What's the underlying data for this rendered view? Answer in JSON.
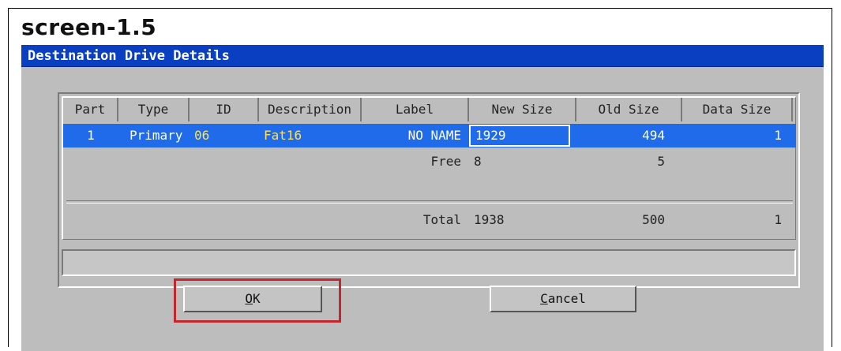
{
  "caption": "screen-1.5",
  "dialog": {
    "title": "Destination Drive Details",
    "columns": [
      "Part",
      "Type",
      "ID",
      "Description",
      "Label",
      "New Size",
      "Old Size",
      "Data Size"
    ],
    "rows": [
      {
        "part": "1",
        "type": "Primary",
        "id": "06",
        "description": "Fat16",
        "label": "NO NAME",
        "new_size": "1929",
        "old_size": "494",
        "data_size": "1"
      }
    ],
    "free": {
      "label": "Free",
      "new_size": "8",
      "old_size": "5"
    },
    "total": {
      "label": "Total",
      "new_size": "1938",
      "old_size": "500",
      "data_size": "1"
    },
    "buttons": {
      "ok": {
        "mnemonic": "O",
        "rest": "K"
      },
      "cancel": {
        "mnemonic": "C",
        "rest": "ancel"
      }
    }
  },
  "colors": {
    "titlebar": "#0a3fc2",
    "selection": "#1f6bea",
    "highlight_box": "#c0282d",
    "dialog_bg": "#bdbdbd"
  }
}
